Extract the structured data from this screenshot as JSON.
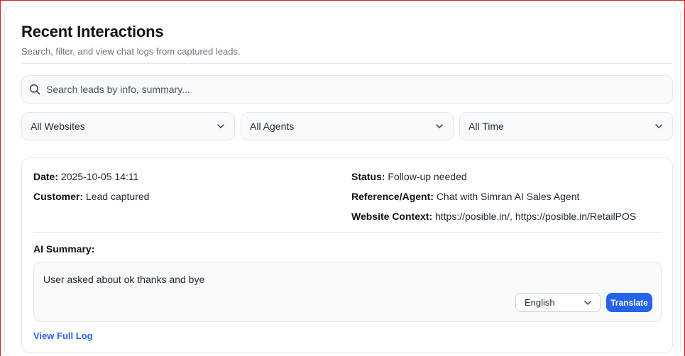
{
  "header": {
    "title": "Recent Interactions",
    "subtitle": "Search, filter, and view chat logs from captured leads."
  },
  "search": {
    "placeholder": "Search leads by info, summary..."
  },
  "filters": {
    "websites": "All Websites",
    "agents": "All Agents",
    "time": "All Time"
  },
  "interaction": {
    "date_label": "Date:",
    "date": "2025-10-05 14:11",
    "customer_label": "Customer:",
    "customer": "Lead captured",
    "status_label": "Status:",
    "status": "Follow-up needed",
    "reference_label": "Reference/Agent:",
    "reference": "Chat with Simran AI Sales Agent",
    "website_label": "Website Context:",
    "website": "https://posible.in/, https://posible.in/RetailPOS",
    "summary_label": "AI Summary:",
    "summary": "User asked about ok thanks and bye",
    "language": "English",
    "translate_label": "Translate",
    "view_log_label": "View Full Log"
  },
  "icons": {
    "search": "search-icon",
    "dropdown": "chevron-down-icon"
  },
  "colors": {
    "accent": "#2563eb",
    "frame_border": "#d9232b"
  }
}
